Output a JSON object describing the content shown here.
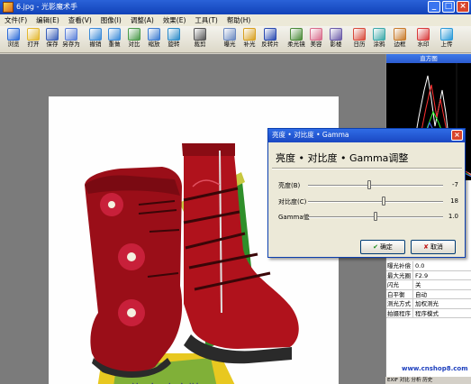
{
  "window": {
    "title": "6.jpg - 光影魔术手"
  },
  "menu": [
    "文件(F)",
    "编辑(E)",
    "查看(V)",
    "图像(I)",
    "调整(A)",
    "效果(E)",
    "工具(T)",
    "帮助(H)"
  ],
  "toolbar": [
    {
      "label": "浏览",
      "icon": "browse-icon",
      "color": "#2a6ad8"
    },
    {
      "label": "打开",
      "icon": "open-icon",
      "color": "#e3b72e"
    },
    {
      "label": "保存",
      "icon": "save-icon",
      "color": "#3a5fb8"
    },
    {
      "label": "另存为",
      "icon": "save-as-icon",
      "color": "#5a7fd8"
    },
    {
      "label": "撤销",
      "icon": "undo-icon",
      "color": "#3a8ad8"
    },
    {
      "label": "重做",
      "icon": "redo-icon",
      "color": "#3a8ad8"
    },
    {
      "label": "对比",
      "icon": "compare-icon",
      "color": "#4a9a4a"
    },
    {
      "label": "缩放",
      "icon": "zoom-icon",
      "color": "#3a7ad0"
    },
    {
      "label": "旋转",
      "icon": "rotate-icon",
      "color": "#2a8ac8"
    },
    {
      "label": "裁剪",
      "icon": "crop-icon",
      "color": "#555555"
    },
    {
      "label": "曝光",
      "icon": "exposure-icon",
      "color": "#6a88c0"
    },
    {
      "label": "补光",
      "icon": "fill-light-icon",
      "color": "#d8a020"
    },
    {
      "label": "反转片",
      "icon": "slide-film-icon",
      "color": "#2a4ab0"
    },
    {
      "label": "柔光镜",
      "icon": "soft-lens-icon",
      "color": "#4a8a38"
    },
    {
      "label": "美容",
      "icon": "beauty-icon",
      "color": "#d86a8a"
    },
    {
      "label": "影楼",
      "icon": "studio-icon",
      "color": "#6a5aa8"
    },
    {
      "label": "日历",
      "icon": "calendar-icon",
      "color": "#d84a3a"
    },
    {
      "label": "涂鸦",
      "icon": "doodle-icon",
      "color": "#3aa8a8"
    },
    {
      "label": "边框",
      "icon": "frame-icon",
      "color": "#c87a2a"
    },
    {
      "label": "水印",
      "icon": "watermark-icon",
      "color": "#d83a3a"
    },
    {
      "label": "上传",
      "icon": "upload-icon",
      "color": "#2a9ad8"
    }
  ],
  "panel": {
    "histogram_title": "直方图",
    "exif": [
      {
        "k": "曝光补偿",
        "v": "0.0"
      },
      {
        "k": "最大光圈",
        "v": "F2.9"
      },
      {
        "k": "闪光",
        "v": "关"
      },
      {
        "k": "白平衡",
        "v": "自动"
      },
      {
        "k": "测光方式",
        "v": "加权测光"
      },
      {
        "k": "拍摄程序",
        "v": "程序模式"
      }
    ],
    "side_numbers": [
      "0",
      "3"
    ],
    "site_url": "www.cnshop8.com",
    "tabs": "EXIF 对比 分析 历史"
  },
  "dialog": {
    "title": "亮度 • 对比度 • Gamma",
    "heading": "亮度 • 对比度 • Gamma调整",
    "sliders": [
      {
        "label": "亮度(B)",
        "value": "-7",
        "level": 0.45
      },
      {
        "label": "对比度(C)",
        "value": "18",
        "level": 0.56
      },
      {
        "label": "Gamma值",
        "value": "1.0",
        "level": 0.5
      }
    ],
    "ok_label": "确定",
    "cancel_label": "取消"
  },
  "colors": {
    "title_bar": "#1f52c8",
    "boot_red": "#a0101a",
    "box_green": "#2a8a2a"
  }
}
